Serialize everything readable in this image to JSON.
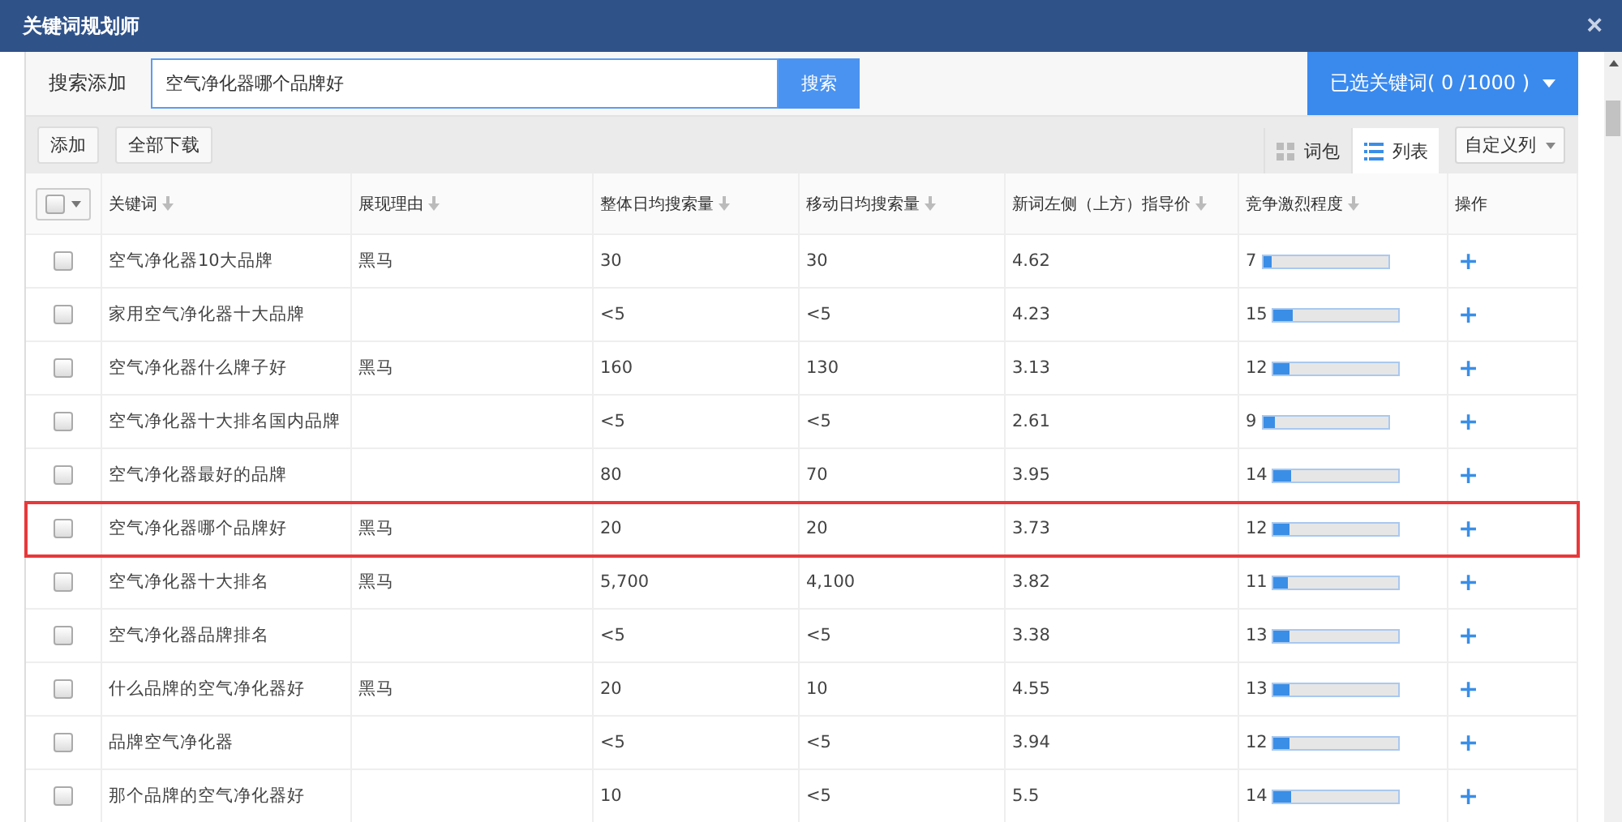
{
  "window": {
    "title": "关键词规划师",
    "close": "×"
  },
  "search": {
    "label": "搜索添加",
    "value": "空气净化器哪个品牌好",
    "button": "搜索"
  },
  "selected_button": {
    "label": "已选关键词( 0 /1000 )"
  },
  "toolbar": {
    "buttons": [
      "添加",
      "全部下载"
    ],
    "views": [
      {
        "label": "词包",
        "kind": "grid",
        "selected": false
      },
      {
        "label": "列表",
        "kind": "list",
        "selected": true
      }
    ],
    "custom_columns": "自定义列"
  },
  "table": {
    "select_all": {
      "checked": false
    },
    "columns": [
      {
        "label": "关键词",
        "sortable": true
      },
      {
        "label": "展现理由",
        "sortable": true
      },
      {
        "label": "整体日均搜索量",
        "sortable": true
      },
      {
        "label": "移动日均搜索量",
        "sortable": true
      },
      {
        "label": "新词左侧（上方）指导价",
        "sortable": true
      },
      {
        "label": "竞争激烈程度",
        "sortable": true
      },
      {
        "label": "操作",
        "sortable": false
      }
    ],
    "rows": [
      {
        "checked": false,
        "highlighted": false,
        "keyword": "空气净化器10大品牌",
        "reason": "黑马",
        "total": "30",
        "mobile": "30",
        "price": "4.62",
        "competition": "7",
        "level": 0.07,
        "action": "+"
      },
      {
        "checked": false,
        "highlighted": false,
        "keyword": "家用空气净化器十大品牌",
        "total": "<5",
        "mobile": "<5",
        "price": "4.23",
        "competition": "15",
        "level": 0.15,
        "action": "+"
      },
      {
        "checked": false,
        "highlighted": false,
        "keyword": "空气净化器什么牌子好",
        "reason": "黑马",
        "total": "160",
        "mobile": "130",
        "price": "3.13",
        "competition": "12",
        "level": 0.12,
        "action": "+"
      },
      {
        "checked": false,
        "highlighted": false,
        "keyword": "空气净化器十大排名国内品牌",
        "total": "<5",
        "mobile": "<5",
        "price": "2.61",
        "competition": "9",
        "level": 0.09,
        "action": "+"
      },
      {
        "checked": false,
        "highlighted": false,
        "keyword": "空气净化器最好的品牌",
        "total": "80",
        "mobile": "70",
        "price": "3.95",
        "competition": "14",
        "level": 0.14,
        "action": "+"
      },
      {
        "checked": false,
        "highlighted": true,
        "keyword": "空气净化器哪个品牌好",
        "reason": "黑马",
        "total": "20",
        "mobile": "20",
        "price": "3.73",
        "competition": "12",
        "level": 0.12,
        "action": "+"
      },
      {
        "checked": false,
        "highlighted": false,
        "keyword": "空气净化器十大排名",
        "reason": "黑马",
        "total": "5,700",
        "mobile": "4,100",
        "price": "3.82",
        "competition": "11",
        "level": 0.11,
        "action": "+"
      },
      {
        "checked": false,
        "highlighted": false,
        "keyword": "空气净化器品牌排名",
        "total": "<5",
        "mobile": "<5",
        "price": "3.38",
        "competition": "13",
        "level": 0.13,
        "action": "+"
      },
      {
        "checked": false,
        "highlighted": false,
        "keyword": "什么品牌的空气净化器好",
        "reason": "黑马",
        "total": "20",
        "mobile": "10",
        "price": "4.55",
        "competition": "13",
        "level": 0.13,
        "action": "+"
      },
      {
        "checked": false,
        "highlighted": false,
        "keyword": "品牌空气净化器",
        "total": "<5",
        "mobile": "<5",
        "price": "3.94",
        "competition": "12",
        "level": 0.12,
        "action": "+"
      },
      {
        "checked": false,
        "highlighted": false,
        "keyword": "那个品牌的空气净化器好",
        "total": "10",
        "mobile": "<5",
        "price": "5.5",
        "competition": "14",
        "level": 0.14,
        "action": "+"
      }
    ]
  }
}
